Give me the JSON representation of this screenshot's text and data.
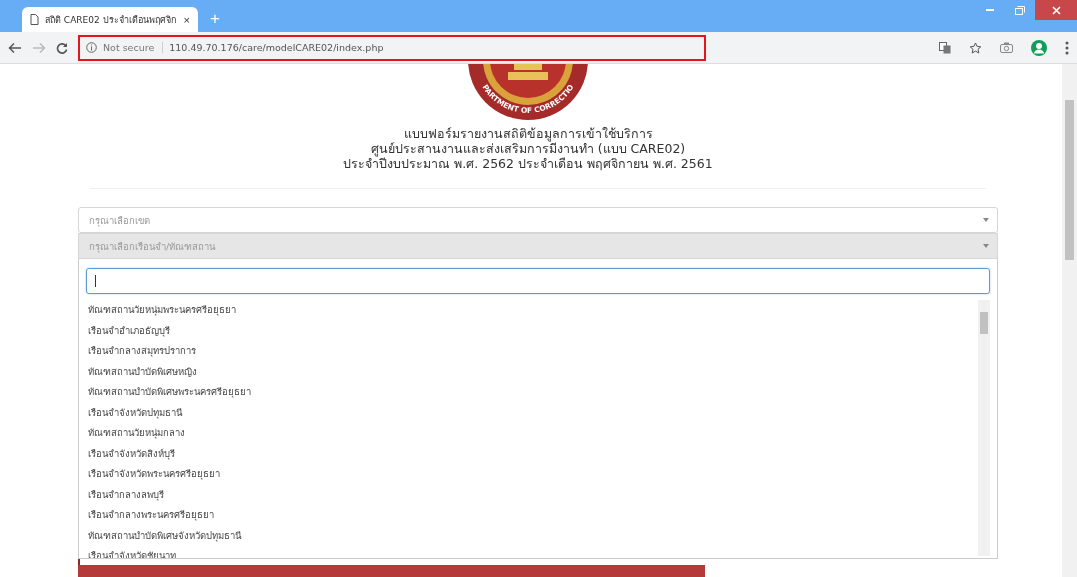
{
  "browser": {
    "tab": {
      "title": "สถิติ CARE02 ประจำเดือนพฤศจิก",
      "close": "×"
    },
    "new_tab": "+",
    "security": "Not secure",
    "url": "110.49.70.176/care/modelCARE02/index.php",
    "url_highlighted": true
  },
  "logo": {
    "text": "PARTMENT OF CORRECTIO"
  },
  "heading": [
    "แบบฟอร์มรายงานสถิติข้อมูลการเข้าใช้บริการ",
    "ศูนย์ประสานงานและส่งเสริมการมีงานทำ (แบบ CARE02)",
    "ประจำปีงบประมาณ พ.ศ. 2562 ประจำเดือน พฤศจิกายน พ.ศ. 2561"
  ],
  "selects": [
    {
      "placeholder": "กรุณาเลือกเขต",
      "disabled": false
    },
    {
      "placeholder": "กรุณาเลือกเรือนจำ/ทัณฑสถาน",
      "disabled": true
    }
  ],
  "dropdown": {
    "options": [
      {
        "label": "ทัณฑสถานวัยหนุ่มพระนครศรีอยุธยา"
      },
      {
        "label": "เรือนจำอำเภอธัญบุรี"
      },
      {
        "label": "เรือนจำกลางสมุทรปราการ"
      },
      {
        "label": "ทัณฑสถานบำบัดพิเศษหญิง"
      },
      {
        "label": "ทัณฑสถานบำบัดพิเศษพระนครศรีอยุธยา"
      },
      {
        "label": "เรือนจำจังหวัดปทุมธานี"
      },
      {
        "label": "ทัณฑสถานวัยหนุ่มกลาง"
      },
      {
        "label": "เรือนจำจังหวัดสิงห์บุรี"
      },
      {
        "label": "เรือนจำจังหวัดพระนครศรีอยุธยา"
      },
      {
        "label": "เรือนจำกลางลพบุรี"
      },
      {
        "label": "เรือนจำกลางพระนครศรีอยุธยา"
      },
      {
        "label": "ทัณฑสถานบำบัดพิเศษจังหวัดปทุมธานี"
      },
      {
        "label": "เรือนจำจังหวัดชัยนาท"
      }
    ]
  }
}
